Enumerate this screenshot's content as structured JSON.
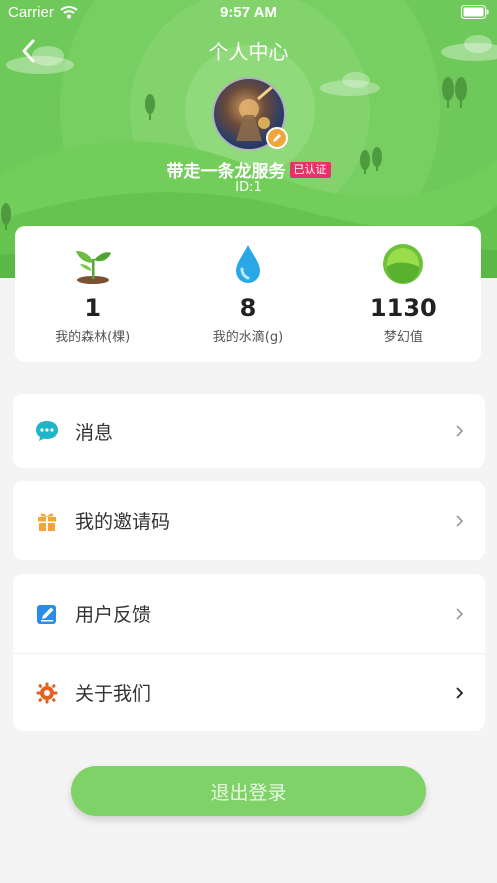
{
  "status": {
    "carrier": "Carrier",
    "time": "9:57 AM"
  },
  "nav": {
    "title": "个人中心"
  },
  "user": {
    "name": "带走一条龙服务",
    "badge": "已认证",
    "id": "ID:1"
  },
  "stats": [
    {
      "icon": "sprout-icon",
      "value": "1",
      "label": "我的森林(棵)"
    },
    {
      "icon": "water-drop-icon",
      "value": "8",
      "label": "我的水滴(g)"
    },
    {
      "icon": "dream-orb-icon",
      "value": "1130",
      "label": "梦幻值"
    }
  ],
  "menu": {
    "messages": "消息",
    "invite": "我的邀请码",
    "feedback": "用户反馈",
    "about": "关于我们"
  },
  "logout": "退出登录",
  "colors": {
    "accent": "#7ed267",
    "badge": "#e8316b"
  }
}
